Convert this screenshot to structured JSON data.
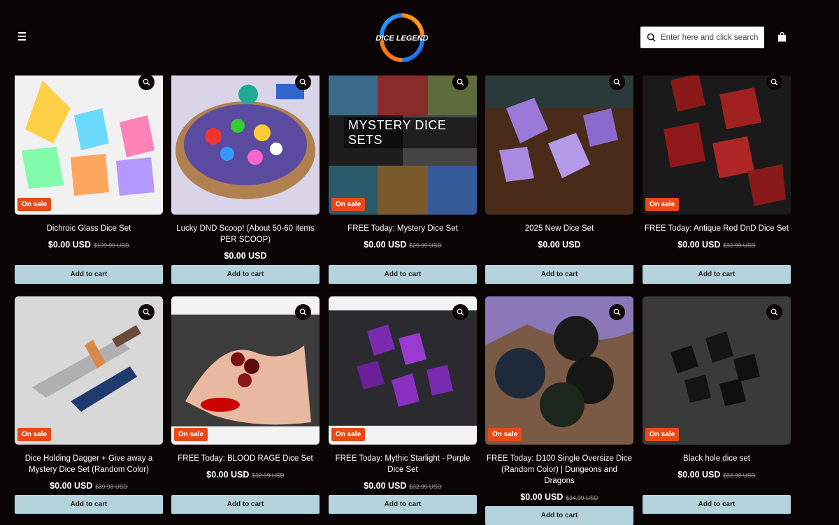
{
  "header": {
    "menu_icon": "hamburger-menu-icon",
    "logo_text": "DICE LEGEND",
    "search_placeholder": "Enter here and click search",
    "cart_icon": "shopping-bag-icon"
  },
  "colors": {
    "background": "#0b0405",
    "badge": "#e64a19",
    "button": "#b5d3dd"
  },
  "products": [
    {
      "title": "Dichroic Glass Dice Set",
      "price": "$0.00 USD",
      "old_price": "$199.99 USD",
      "badge": "On sale",
      "button": "Add to cart"
    },
    {
      "title": "Lucky DND Scoop! (About 50-60 items PER SCOOP)",
      "price": "$0.00 USD",
      "old_price": "",
      "badge": "",
      "button": "Add to cart"
    },
    {
      "title": "FREE Today: Mystery Dice Set",
      "price": "$0.00 USD",
      "old_price": "$29.99 USD",
      "badge": "On sale",
      "button": "Add to cart",
      "image_text": "MYSTERY DICE SETS"
    },
    {
      "title": "2025 New Dice Set",
      "price": "$0.00 USD",
      "old_price": "",
      "badge": "",
      "button": "Add to cart"
    },
    {
      "title": "FREE Today: Antique Red DnD Dice Set",
      "price": "$0.00 USD",
      "old_price": "$32.99 USD",
      "badge": "On sale",
      "button": "Add to cart"
    },
    {
      "title": "Dice Holding Dagger + Give away a Mystery Dice Set (Random Color)",
      "price": "$0.00 USD",
      "old_price": "$39.98 USD",
      "badge": "On sale",
      "button": "Add to cart"
    },
    {
      "title": "FREE Today: BLOOD RAGE Dice Set",
      "price": "$0.00 USD",
      "old_price": "$32.99 USD",
      "badge": "On sale",
      "button": "Add to cart"
    },
    {
      "title": "FREE Today: Mythic Starlight - Purple Dice Set",
      "price": "$0.00 USD",
      "old_price": "$32.99 USD",
      "badge": "On sale",
      "button": "Add to cart"
    },
    {
      "title": "FREE Today: D100 Single Oversize Dice (Random Color) | Dungeons and Dragons",
      "price": "$0.00 USD",
      "old_price": "$34.99 USD",
      "badge": "On sale",
      "button": "Add to cart"
    },
    {
      "title": "Black hole dice set",
      "price": "$0.00 USD",
      "old_price": "$32.99 USD",
      "badge": "On sale",
      "button": "Add to cart"
    }
  ]
}
